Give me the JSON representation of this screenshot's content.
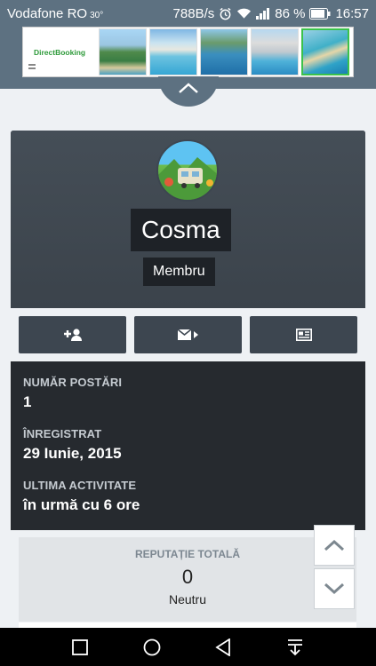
{
  "status_bar": {
    "carrier": "Vodafone RO",
    "temperature": "30°",
    "net_speed": "788B/s",
    "battery": "86 %",
    "time": "16:57"
  },
  "ad": {
    "brand": "DirectBooking",
    "thumbnails": [
      "resort-photo-1",
      "resort-photo-2",
      "resort-photo-3",
      "resort-photo-4",
      "resort-photo-5"
    ],
    "selected_index": 4
  },
  "profile": {
    "name": "Cosma",
    "role": "Membru",
    "actions": [
      {
        "icon": "add-friend-icon"
      },
      {
        "icon": "send-message-icon"
      },
      {
        "icon": "view-content-icon"
      }
    ]
  },
  "stats": [
    {
      "label": "NUMĂR POSTĂRI",
      "value": "1"
    },
    {
      "label": "ÎNREGISTRAT",
      "value": "29 Iunie, 2015"
    },
    {
      "label": "ULTIMA ACTIVITATE",
      "value": "în urmă cu 6 ore"
    }
  ],
  "reputation": {
    "label": "REPUTAȚIE TOTALĂ",
    "value": "0",
    "status": "Neutru"
  },
  "colors": {
    "header": "#5d7181",
    "card": "#3d4650",
    "stats_bg": "#262a2f",
    "ad_accent": "#2e9a3a"
  }
}
